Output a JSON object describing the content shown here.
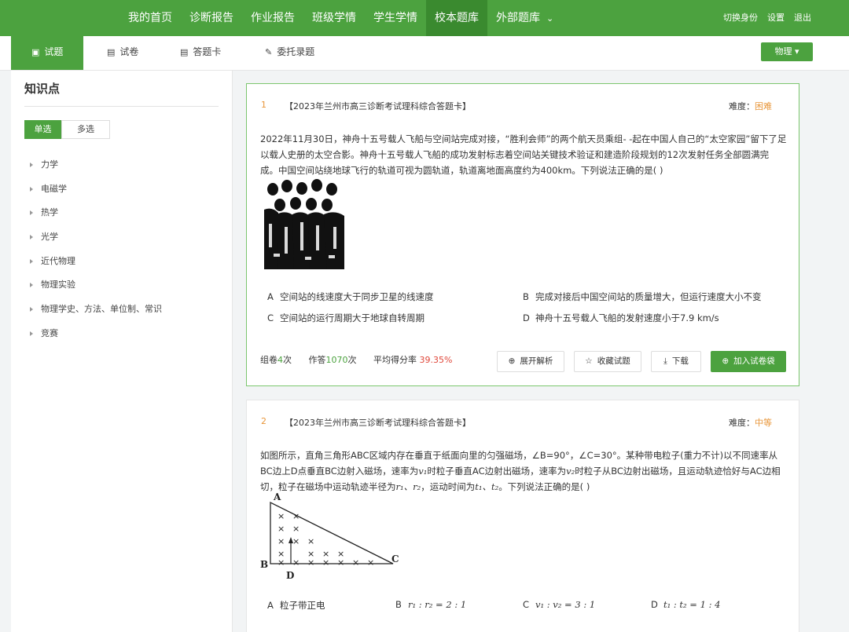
{
  "nav": {
    "items": [
      {
        "label": "我的首页",
        "active": false
      },
      {
        "label": "诊断报告",
        "active": false
      },
      {
        "label": "作业报告",
        "active": false
      },
      {
        "label": "班级学情",
        "active": false
      },
      {
        "label": "学生学情",
        "active": false
      },
      {
        "label": "校本题库",
        "active": true
      },
      {
        "label": "外部题库",
        "active": false
      }
    ],
    "right": [
      "切换身份",
      "设置",
      "退出"
    ]
  },
  "subnav": {
    "tabs": [
      "试题",
      "试卷",
      "答题卡",
      "委托录题"
    ],
    "subject": "物理"
  },
  "sidebar": {
    "title": "知识点",
    "toggle": [
      "单选",
      "多选"
    ],
    "items": [
      "力学",
      "电磁学",
      "热学",
      "光学",
      "近代物理",
      "物理实验",
      "物理学史、方法、单位制、常识",
      "竞赛"
    ]
  },
  "questions": [
    {
      "no": "1",
      "source": "【2023年兰州市高三诊断考试理科综合答题卡】",
      "difficulty_label": "难度：",
      "difficulty": "困难",
      "stem": "2022年11月30日，神舟十五号载人飞船与空间站完成对接，“胜利会师”的两个航天员乘组- -起在中国人自己的“太空家园”留下了足以载人史册的太空合影。神舟十五号载人飞船的成功发射标志着空间站关键技术验证和建造阶段规划的12次发射任务全部圆满完成。中国空间站绕地球飞行的轨道可视为圆轨道，轨道离地面高度约为400km。下列说法正确的是(    )",
      "options": [
        {
          "letter": "A",
          "text": "空间站的线速度大于同步卫星的线速度"
        },
        {
          "letter": "B",
          "text": "完成对接后中国空间站的质量增大，但运行速度大小不变"
        },
        {
          "letter": "C",
          "text": "空间站的运行周期大于地球自转周期"
        },
        {
          "letter": "D",
          "text": "神舟十五号载人飞船的发射速度小于7.9 km/s"
        }
      ],
      "stats": {
        "zujuan_prefix": "组卷",
        "zujuan": "4",
        "zujuan_suffix": "次",
        "zuoda_prefix": "作答",
        "zuoda": "1070",
        "zuoda_suffix": "次",
        "rate_prefix": "平均得分率 ",
        "rate": "39.35%"
      },
      "buttons": [
        "展开解析",
        "收藏试题",
        "下载",
        "加入试卷袋"
      ]
    },
    {
      "no": "2",
      "source": "【2023年兰州市高三诊断考试理科综合答题卡】",
      "difficulty_label": "难度：",
      "difficulty": "中等",
      "stem_a": "如图所示，直角三角形ABC区域内存在垂直于纸面向里的匀强磁场，∠B=90°，∠C=30°。某种带电粒子(重力不计)以不同速率从BC边上D点垂直BC边射入磁场，速率为",
      "stem_v1": "v₁",
      "stem_b": "时粒子垂直AC边射出磁场，速率为",
      "stem_v2": "v₂",
      "stem_c": "时粒子从BC边射出磁场，且运动轨迹恰好与AC边相切，粒子在磁场中运动轨迹半径为",
      "stem_r": "r₁、r₂",
      "stem_d": "，运动时间为",
      "stem_t": "t₁、t₂",
      "stem_e": "。下列说法正确的是(    )",
      "figure": {
        "A": "A",
        "B": "B",
        "C": "C",
        "D": "D"
      },
      "options": [
        {
          "letter": "A",
          "text": "粒子带正电"
        },
        {
          "letter": "B",
          "text": "r₁ : r₂ = 2 : 1"
        },
        {
          "letter": "C",
          "text": "v₁ : v₂ = 3 : 1"
        },
        {
          "letter": "D",
          "text": "t₁ : t₂ = 1 : 4"
        }
      ]
    }
  ]
}
